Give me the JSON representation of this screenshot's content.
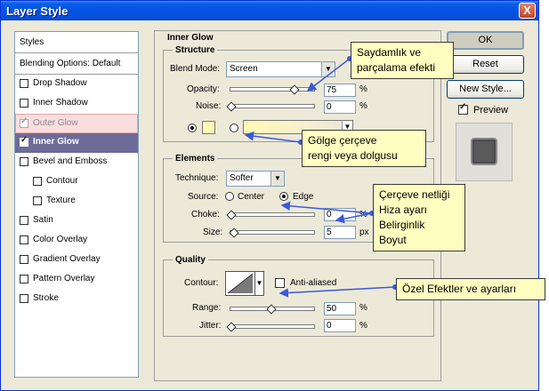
{
  "window": {
    "title": "Layer Style",
    "close_label": "X"
  },
  "styles_panel": {
    "header": "Styles",
    "blending_options": "Blending Options: Default",
    "items": [
      {
        "label": "Drop Shadow",
        "checked": false
      },
      {
        "label": "Inner Shadow",
        "checked": false
      },
      {
        "label": "Outer Glow",
        "checked": true
      },
      {
        "label": "Inner Glow",
        "checked": true
      },
      {
        "label": "Bevel and Emboss",
        "checked": false
      },
      {
        "label": "Contour",
        "checked": false
      },
      {
        "label": "Texture",
        "checked": false
      },
      {
        "label": "Satin",
        "checked": false
      },
      {
        "label": "Color Overlay",
        "checked": false
      },
      {
        "label": "Gradient Overlay",
        "checked": false
      },
      {
        "label": "Pattern Overlay",
        "checked": false
      },
      {
        "label": "Stroke",
        "checked": false
      }
    ]
  },
  "inner_glow": {
    "title": "Inner Glow",
    "structure": {
      "title": "Structure",
      "blend_mode_label": "Blend Mode:",
      "blend_mode_value": "Screen",
      "opacity_label": "Opacity:",
      "opacity_value": "75",
      "noise_label": "Noise:",
      "noise_value": "0",
      "percent": "%",
      "glow_color": "#fefbb3"
    },
    "elements": {
      "title": "Elements",
      "technique_label": "Technique:",
      "technique_value": "Softer",
      "source_label": "Source:",
      "source_center": "Center",
      "source_edge": "Edge",
      "choke_label": "Choke:",
      "choke_value": "0",
      "size_label": "Size:",
      "size_value": "5",
      "px": "px",
      "percent": "%"
    },
    "quality": {
      "title": "Quality",
      "contour_label": "Contour:",
      "anti_aliased_label": "Anti-aliased",
      "range_label": "Range:",
      "range_value": "50",
      "jitter_label": "Jitter:",
      "jitter_value": "0",
      "percent": "%"
    }
  },
  "buttons": {
    "ok": "OK",
    "reset": "Reset",
    "new_style": "New Style...",
    "preview": "Preview",
    "preview_checked": true
  },
  "callouts": {
    "transparency": [
      "Saydamlık ve",
      "parçalama efekti"
    ],
    "glow_color": [
      "Gölge çerçeve",
      "rengi veya dolgusu"
    ],
    "edge": [
      "Çerçeve netliği",
      "Hiza ayarı",
      "Belirginlik",
      "Boyut"
    ],
    "special": [
      "Özel Efektler ve ayarları"
    ]
  }
}
